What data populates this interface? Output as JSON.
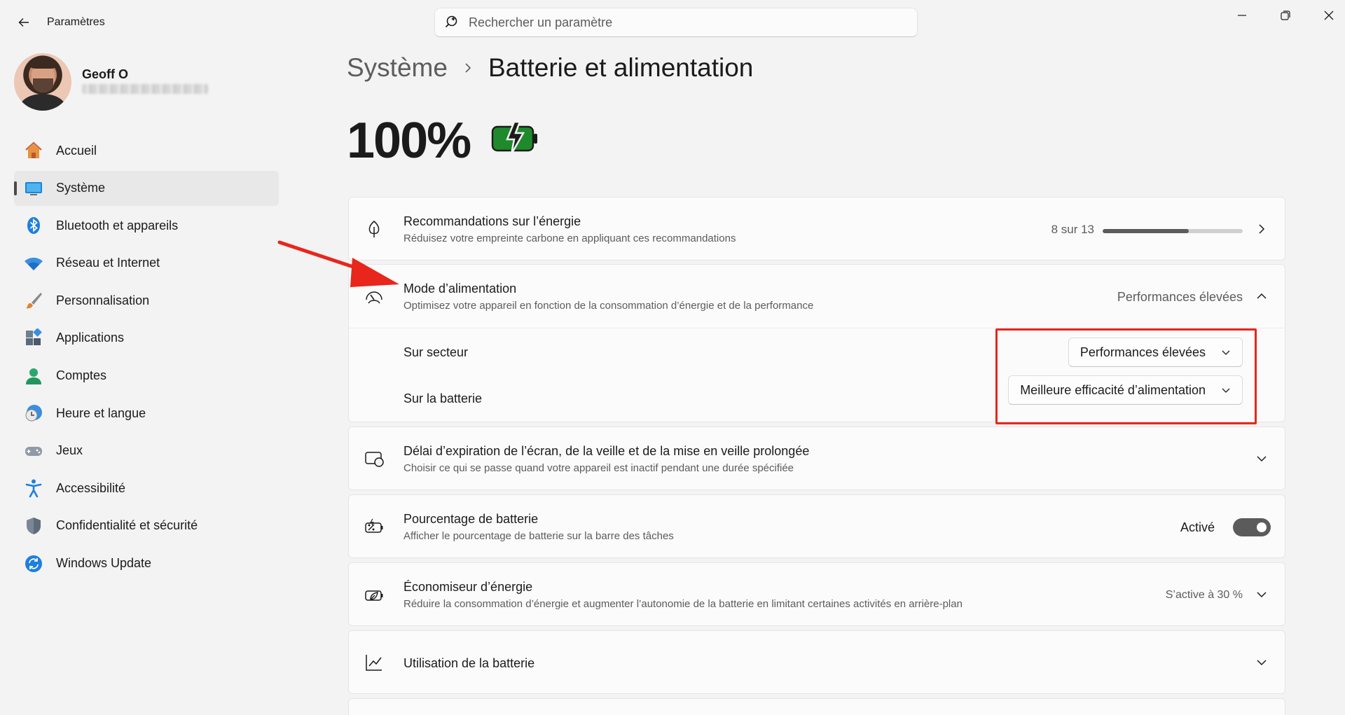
{
  "window": {
    "app_title": "Paramètres",
    "icons": {
      "back": "back-arrow-icon",
      "minimize": "minimize-icon",
      "maximize": "restore-icon",
      "close": "close-icon"
    }
  },
  "search": {
    "placeholder": "Rechercher un paramètre",
    "icon": "search-icon"
  },
  "profile": {
    "name": "Geoff O"
  },
  "sidebar": {
    "items": [
      {
        "label": "Accueil",
        "icon": "home-icon"
      },
      {
        "label": "Système",
        "icon": "system-icon",
        "active": true
      },
      {
        "label": "Bluetooth et appareils",
        "icon": "bluetooth-icon"
      },
      {
        "label": "Réseau et Internet",
        "icon": "wifi-icon"
      },
      {
        "label": "Personnalisation",
        "icon": "brush-icon"
      },
      {
        "label": "Applications",
        "icon": "apps-icon"
      },
      {
        "label": "Comptes",
        "icon": "account-icon"
      },
      {
        "label": "Heure et langue",
        "icon": "clock-globe-icon"
      },
      {
        "label": "Jeux",
        "icon": "gamepad-icon"
      },
      {
        "label": "Accessibilité",
        "icon": "accessibility-icon"
      },
      {
        "label": "Confidentialité et sécurité",
        "icon": "shield-icon"
      },
      {
        "label": "Windows Update",
        "icon": "update-icon"
      }
    ]
  },
  "breadcrumb": {
    "parent": "Système",
    "current": "Batterie et alimentation"
  },
  "battery": {
    "percent": "100%",
    "icon": "battery-charging-icon",
    "accent": "#1f8a2b"
  },
  "cards": {
    "energy": {
      "title": "Recommandations sur l’énergie",
      "desc": "Réduisez votre empreinte carbone en appliquant ces recommandations",
      "progress_text": "8 sur 13",
      "progress_fraction": 0.615,
      "icon": "leaf-icon"
    },
    "power_mode": {
      "title": "Mode d’alimentation",
      "desc": "Optimisez votre appareil en fonction de la consommation d’énergie et de la performance",
      "value": "Performances élevées",
      "icon": "gauge-icon",
      "rows": [
        {
          "label": "Sur secteur",
          "value": "Performances élevées"
        },
        {
          "label": "Sur la batterie",
          "value": "Meilleure efficacité d’alimentation"
        }
      ]
    },
    "screen_timeout": {
      "title": "Délai d’expiration de l’écran, de la veille et de la mise en veille prolongée",
      "desc": "Choisir ce qui se passe quand votre appareil est inactif pendant une durée spécifiée",
      "icon": "screen-sleep-icon"
    },
    "battery_percent": {
      "title": "Pourcentage de batterie",
      "desc": "Afficher le pourcentage de batterie sur la barre des tâches",
      "state": "Activé",
      "icon": "battery-percent-icon"
    },
    "saver": {
      "title": "Économiseur d’énergie",
      "desc": "Réduire la consommation d’énergie et augmenter l’autonomie de la batterie en limitant certaines activités en arrière-plan",
      "value": "S’active à 30 %",
      "icon": "battery-saver-icon"
    },
    "usage": {
      "title": "Utilisation de la batterie",
      "icon": "chart-line-icon"
    }
  },
  "colors": {
    "annotation": "#e8261c",
    "toggle_on": "#5b5b5b"
  }
}
